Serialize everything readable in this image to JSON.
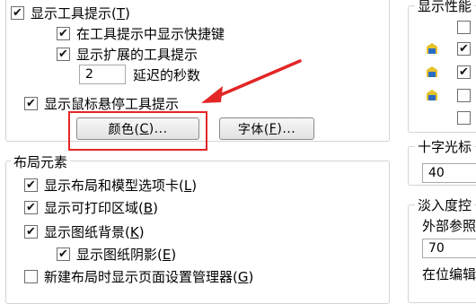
{
  "left": {
    "show_tooltips": {
      "text": "显示工具提示(",
      "key": "T",
      "tail": ")",
      "checked": true
    },
    "show_shortcut": {
      "text": "在工具提示中显示快捷键",
      "checked": true
    },
    "show_extended": {
      "text": "显示扩展的工具提示",
      "checked": true
    },
    "delay_value": "2",
    "delay_label": "延迟的秒数",
    "show_rollover": {
      "text": "显示鼠标悬停工具提示",
      "checked": true
    },
    "color_button": {
      "text": "颜色(",
      "key": "C",
      "tail": ")..."
    },
    "font_button": {
      "text": "字体(",
      "key": "F",
      "tail": ")..."
    },
    "layout_group_title": "布局元素",
    "layout_items": [
      {
        "text": "显示布局和模型选项卡(",
        "key": "L",
        "tail": ")",
        "checked": true
      },
      {
        "text": "显示可打印区域(",
        "key": "B",
        "tail": ")",
        "checked": true
      },
      {
        "text": "显示图纸背景(",
        "key": "K",
        "tail": ")",
        "checked": true
      },
      {
        "text": "显示图纸阴影(",
        "key": "E",
        "tail": ")",
        "checked": true
      },
      {
        "text": "新建布局时显示页面设置管理器(",
        "key": "G",
        "tail": ")",
        "checked": false
      }
    ]
  },
  "right": {
    "perf_group_title": "显示性能",
    "perf_checks": [
      false,
      true,
      true,
      false,
      false
    ],
    "crosshair_title": "十字光标",
    "crosshair_value": "40",
    "fade_title": "淡入度控",
    "xref_label": "外部参照",
    "xref_value": "70",
    "inplace_label": "在位编辑"
  },
  "colors": {
    "annotation": "#e32626",
    "group_border": "#d4d4d4"
  }
}
